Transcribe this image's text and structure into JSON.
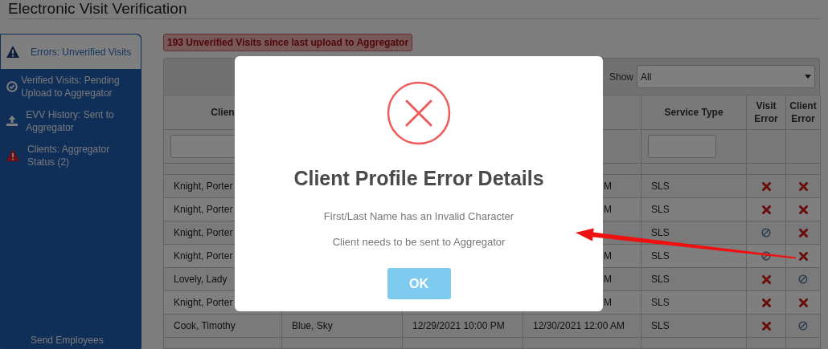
{
  "header": {
    "title": "Electronic Visit Verification"
  },
  "sidebar": {
    "items": [
      {
        "label": "Errors: Unverified Visits",
        "selected": true
      },
      {
        "label": "Verified Visits: Pending Upload to Aggregator",
        "selected": false
      },
      {
        "label": "EVV History: Sent to Aggregator",
        "selected": false
      },
      {
        "label": "Clients: Aggregator Status (2)",
        "selected": false
      }
    ],
    "footer_link": "Send Employees"
  },
  "alert": "193 Unverified Visits since last upload to Aggregator",
  "filter": {
    "label": "Show",
    "value": "All"
  },
  "table": {
    "columns": {
      "column_1": "Clien",
      "service_type": "Service Type",
      "visit_error": "Visit Error",
      "client_error": "Client Error"
    },
    "rows": [
      {
        "client": "Knight, Porter",
        "column_4": "M",
        "service_type": "SLS",
        "visit_error": true,
        "client_error": true
      },
      {
        "client": "Knight, Porter",
        "column_4": "M",
        "service_type": "SLS",
        "visit_error": true,
        "client_error": true
      },
      {
        "client": "Knight, Porter",
        "service_type": "SLS",
        "visit_error": false,
        "client_error": true
      },
      {
        "client": "Knight, Porter",
        "column_4": "M",
        "service_type": "SLS",
        "visit_error": false,
        "client_error": true
      },
      {
        "client": "Lovely, Lady",
        "column_4": "M",
        "service_type": "SLS",
        "visit_error": true,
        "client_error": false
      },
      {
        "client": "Knight, Porter",
        "column_4": "M",
        "service_type": "SLS",
        "visit_error": true,
        "client_error": true
      },
      {
        "client": "Cook, Timothy",
        "column_2": "Blue, Sky",
        "column_3": "12/29/2021 10:00 PM",
        "column_4": "12/30/2021 12:00 AM",
        "service_type": "SLS",
        "visit_error": true,
        "client_error": false
      }
    ]
  },
  "modal": {
    "title": "Client Profile Error Details",
    "messages": [
      "First/Last Name has an Invalid Character",
      "Client needs to be sent to Aggregator"
    ],
    "button": "OK"
  }
}
